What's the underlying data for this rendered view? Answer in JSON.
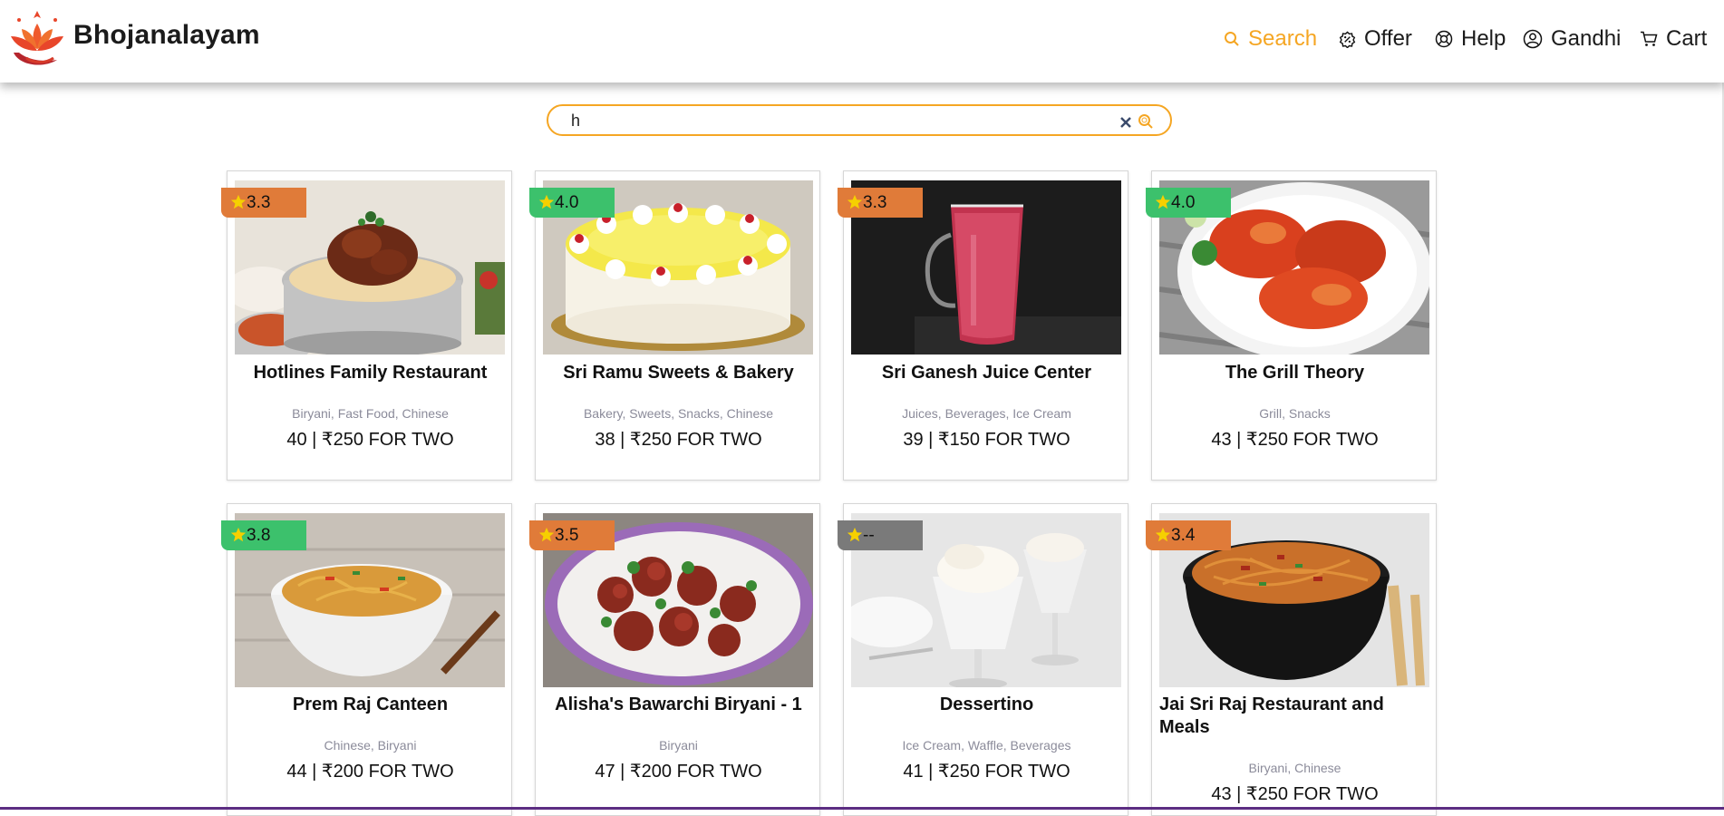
{
  "app": {
    "brand": "Bhojanalayam"
  },
  "nav": {
    "search_label": "Search",
    "offer_label": "Offer",
    "help_label": "Help",
    "user_label": "Gandhi",
    "cart_label": "Cart",
    "active_color": "#f5a623"
  },
  "search": {
    "value": "h"
  },
  "rating_colors": {
    "orange": "#e07b39",
    "green": "#3cc16c",
    "gray": "#7a7a7a"
  },
  "restaurants": [
    {
      "name": "Hotlines Family Restaurant",
      "rating": "3.3",
      "rating_color": "orange",
      "cuisines": "Biryani, Fast Food, Chinese",
      "info": "40 | ₹250 FOR TWO",
      "image": "biryani-bowl"
    },
    {
      "name": "Sri Ramu Sweets & Bakery",
      "rating": "4.0",
      "rating_color": "green",
      "cuisines": "Bakery, Sweets, Snacks, Chinese",
      "info": "38 | ₹250 FOR TWO",
      "image": "pineapple-cake"
    },
    {
      "name": "Sri Ganesh Juice Center",
      "rating": "3.3",
      "rating_color": "orange",
      "cuisines": "Juices, Beverages, Ice Cream",
      "info": "39 | ₹150 FOR TWO",
      "image": "juice-glass"
    },
    {
      "name": "The Grill Theory",
      "rating": "4.0",
      "rating_color": "green",
      "cuisines": "Grill, Snacks",
      "info": "43 | ₹250 FOR TWO",
      "image": "grilled-chicken"
    },
    {
      "name": "Prem Raj Canteen",
      "rating": "3.8",
      "rating_color": "green",
      "cuisines": "Chinese, Biryani",
      "info": "44 | ₹200 FOR TWO",
      "image": "noodles-bowl"
    },
    {
      "name": "Alisha's Bawarchi Biryani - 1",
      "rating": "3.5",
      "rating_color": "orange",
      "cuisines": "Biryani",
      "info": "47 | ₹200 FOR TWO",
      "image": "chilli-chicken"
    },
    {
      "name": "Dessertino",
      "rating": "--",
      "rating_color": "gray",
      "cuisines": "Ice Cream, Waffle, Beverages",
      "info": "41 | ₹250 FOR TWO",
      "image": "ice-cream-sundae"
    },
    {
      "name": "Jai Sri Raj Restaurant and Meals",
      "rating": "3.4",
      "rating_color": "orange",
      "cuisines": "Biryani, Chinese",
      "info": "43 | ₹250 FOR TWO",
      "image": "noodles-box"
    }
  ]
}
